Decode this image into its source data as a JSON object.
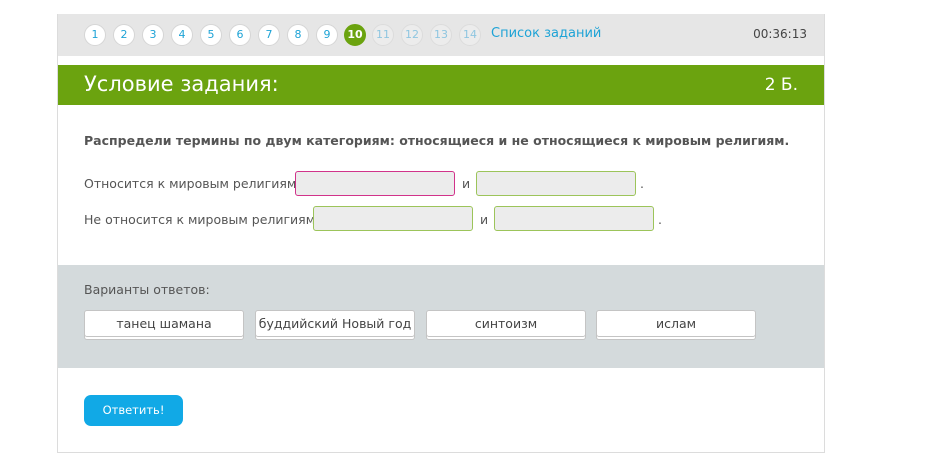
{
  "nav": {
    "questions": [
      "1",
      "2",
      "3",
      "4",
      "5",
      "6",
      "7",
      "8",
      "9",
      "10",
      "11",
      "12",
      "13",
      "14"
    ],
    "current": "10",
    "task_list_label": "Список заданий",
    "timer": "00:36:13"
  },
  "header": {
    "title": "Условие задания:",
    "points": "2 Б."
  },
  "task": {
    "instruction": "Распредели термины по двум категориям: относящиеся и не относящиеся к мировым религиям.",
    "row1_label": "Относится к мировым религиям:",
    "row2_label": "Не относится к мировым религиям:",
    "conjunction": "и",
    "period": "."
  },
  "answers": {
    "caption": "Варианты ответов:",
    "options": [
      "танец шамана",
      "буддийский Новый год",
      "синтоизм",
      "ислам"
    ]
  },
  "submit_label": "Ответить!",
  "colors": {
    "accent_green": "#6ba30f",
    "link_blue": "#1ea3d6",
    "button_blue": "#11a9e6",
    "active_slot": "#d1338a"
  }
}
